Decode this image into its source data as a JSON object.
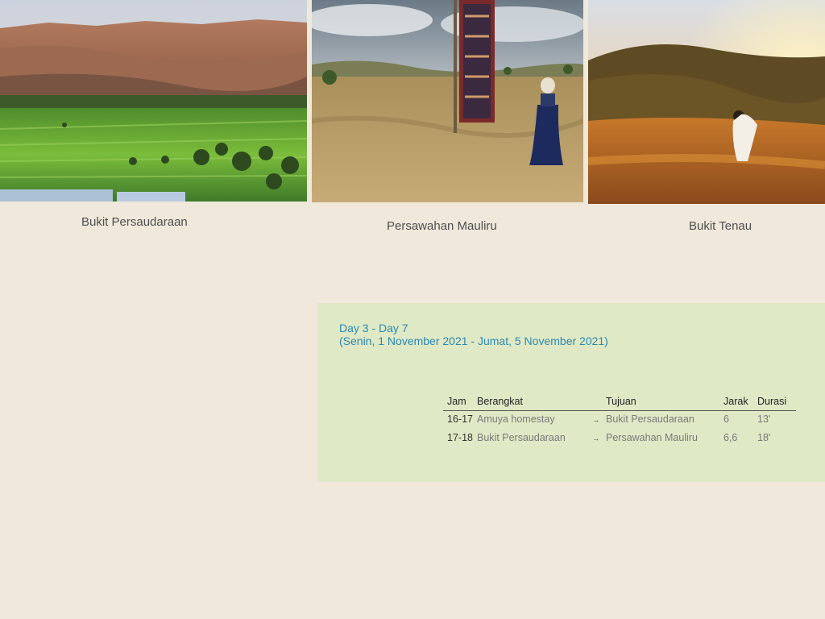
{
  "gallery": [
    {
      "caption": "Bukit Persaudaraan"
    },
    {
      "caption": "Persawahan Mauliru"
    },
    {
      "caption": "Bukit Tenau"
    }
  ],
  "itinerary": {
    "title": "Day 3 - Day 7",
    "date_range": "(Senin, 1 November 2021  - Jumat, 5 November  2021)",
    "headers": {
      "jam": "Jam",
      "from": "Berangkat",
      "to": "Tujuan",
      "distance": "Jarak",
      "duration": "Durasi"
    },
    "rows": [
      {
        "jam": "16-17",
        "from": "Amuya homestay",
        "arrow": "→",
        "to": "Bukit Persaudaraan",
        "distance": "6",
        "duration": "13'"
      },
      {
        "jam": "17-18",
        "from": "Bukit Persaudaraan",
        "arrow": "→",
        "to": "Persawahan Mauliru",
        "distance": "6,6",
        "duration": "18'"
      }
    ]
  },
  "colors": {
    "page_bg": "#efe8db",
    "panel_bg": "#dfe9c6",
    "accent_text": "#2b88b0"
  }
}
